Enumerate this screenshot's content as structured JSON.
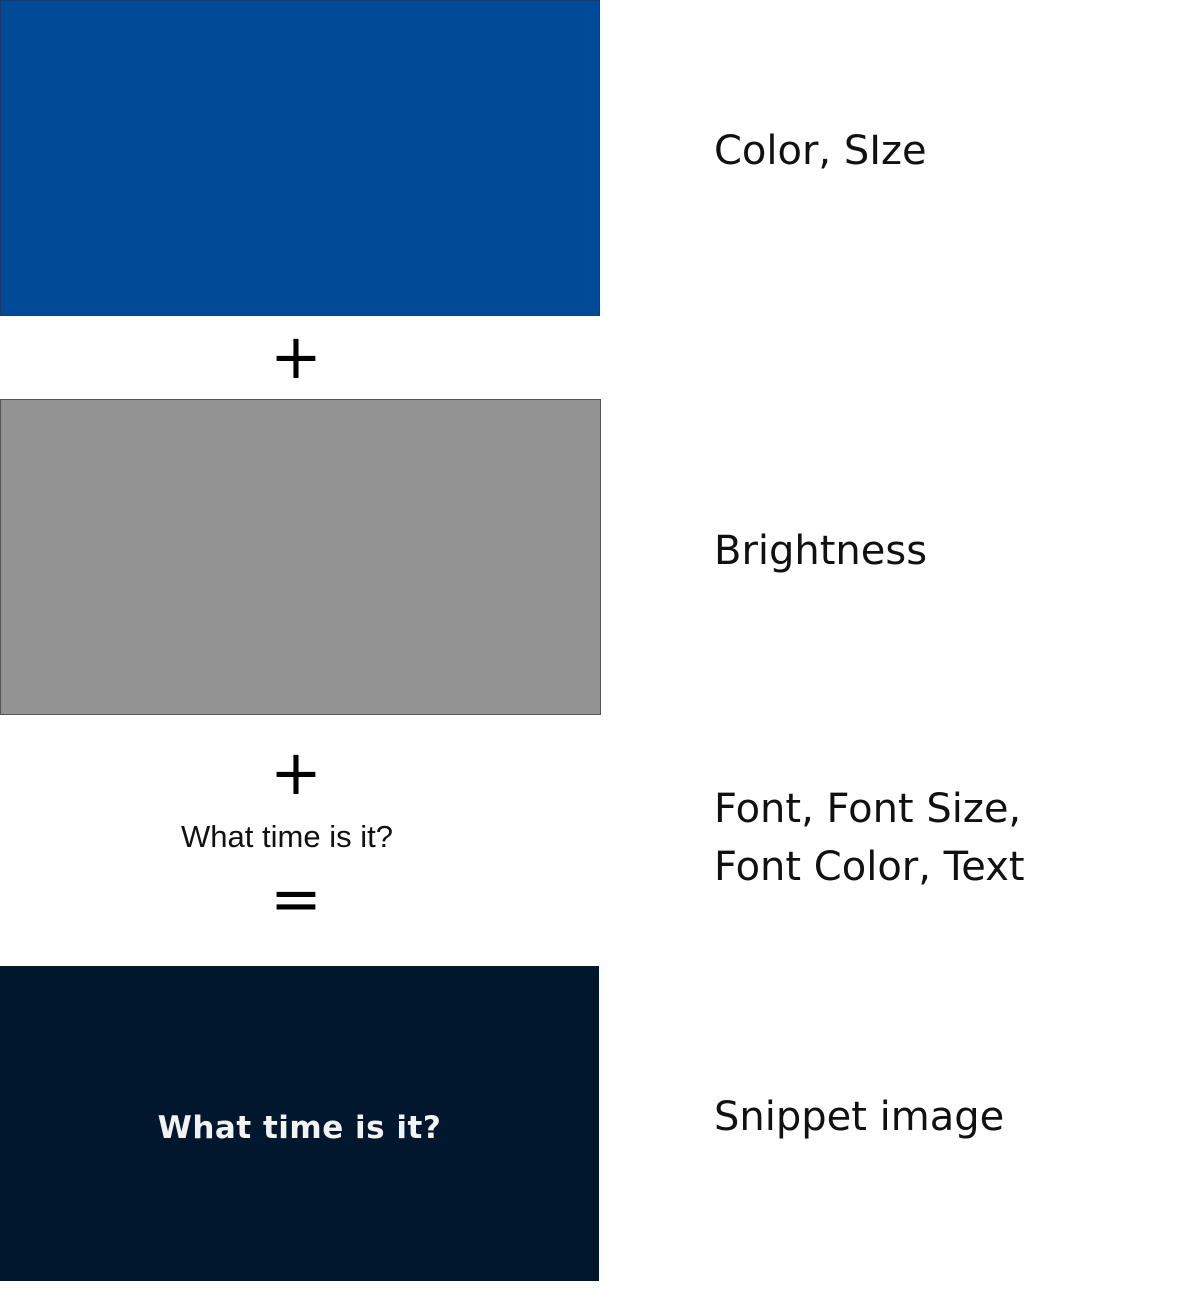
{
  "colors": {
    "color_box": "#004b97",
    "brightness_box": "#939393",
    "snippet_background": "#00172e",
    "snippet_text": "#f2f2f2"
  },
  "operators": {
    "plus_1": "+",
    "plus_2": "+",
    "equals": "="
  },
  "sample_text": "What time is it?",
  "snippet": {
    "text": "What time is it?"
  },
  "labels": {
    "color_size": "Color, SIze",
    "brightness": "Brightness",
    "font_line_1": "Font, Font Size,",
    "font_line_2": "Font Color, Text",
    "snippet_image": "Snippet image"
  }
}
